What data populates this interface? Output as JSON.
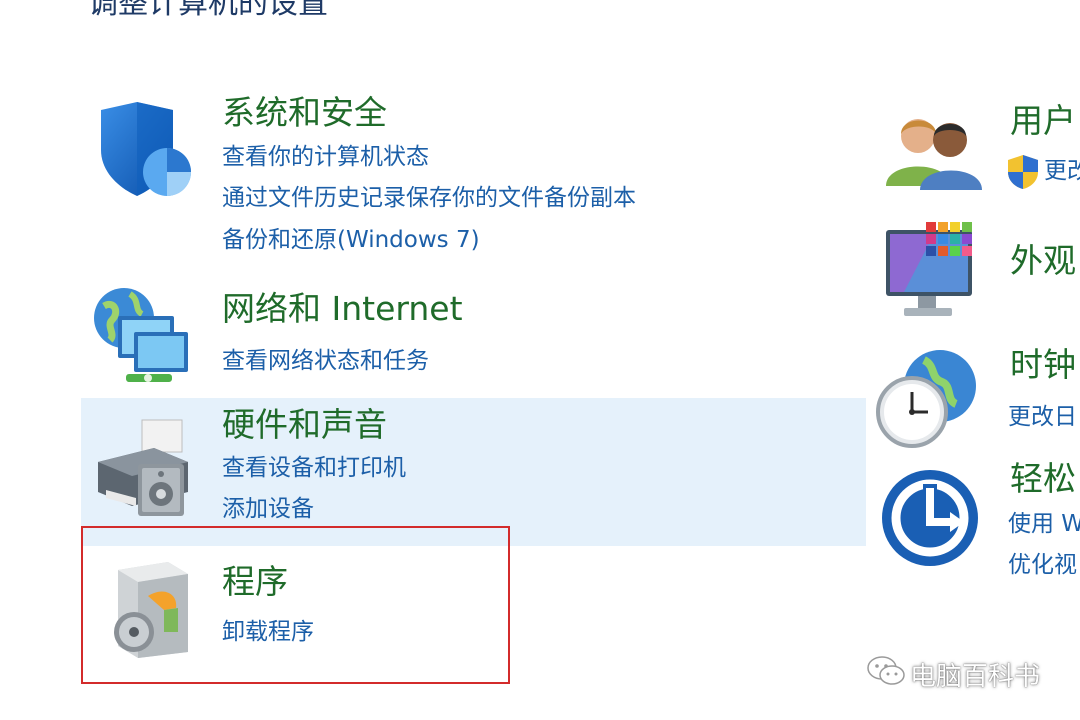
{
  "window": {
    "title": "调整计算机的设置"
  },
  "categories": [
    {
      "title": "系统和安全",
      "links": [
        "查看你的计算机状态",
        "通过文件历史记录保存你的文件备份副本",
        "备份和还原(Windows 7)"
      ],
      "icon": "shield-pie-icon"
    },
    {
      "title": "网络和 Internet",
      "links": [
        "查看网络状态和任务"
      ],
      "icon": "network-globe-icon"
    },
    {
      "title": "硬件和声音",
      "links": [
        "查看设备和打印机",
        "添加设备"
      ],
      "icon": "printer-speaker-icon",
      "hovered": true
    },
    {
      "title": "程序",
      "links": [
        "卸载程序"
      ],
      "icon": "programs-disc-icon",
      "highlighted": true
    }
  ],
  "right_categories": [
    {
      "title": "用户",
      "links": [
        "更改"
      ],
      "icon": "users-icon",
      "link_icon": "uac-shield-icon"
    },
    {
      "title": "外观",
      "links": [],
      "icon": "appearance-monitor-icon"
    },
    {
      "title": "时钟",
      "links": [
        "更改日"
      ],
      "icon": "clock-globe-icon"
    },
    {
      "title": "轻松",
      "links": [
        "使用 W",
        "优化视"
      ],
      "icon": "ease-of-access-icon"
    }
  ],
  "watermark": {
    "text": "电脑百科书",
    "icon": "wechat-icon"
  },
  "colors": {
    "title_green": "#1f6b2a",
    "link_blue": "#1c5fa8",
    "hover_bg": "#e5f1fb",
    "highlight_border": "#d32b2b"
  }
}
